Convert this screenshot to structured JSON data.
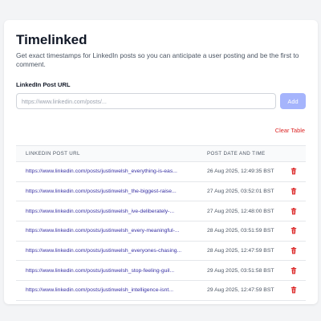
{
  "app": {
    "title": "Timelinked",
    "subtitle": "Get exact timestamps for LinkedIn posts so you can anticipate a user posting and be the first to comment."
  },
  "form": {
    "label": "LinkedIn Post URL",
    "placeholder": "https://www.linkedin.com/posts/...",
    "value": "",
    "add_label": "Add"
  },
  "table": {
    "clear_label": "Clear Table",
    "headers": {
      "url": "LinkedIn Post URL",
      "date": "Post Date and Time"
    },
    "rows": [
      {
        "url": "https://www.linkedin.com/posts/justinwelsh_everything-is-eas...",
        "date": "26 Aug 2025, 12:49:35 BST"
      },
      {
        "url": "https://www.linkedin.com/posts/justinwelsh_the-biggest-raise...",
        "date": "27 Aug 2025, 03:52:01 BST"
      },
      {
        "url": "https://www.linkedin.com/posts/justinwelsh_ive-deliberately-...",
        "date": "27 Aug 2025, 12:48:00 BST"
      },
      {
        "url": "https://www.linkedin.com/posts/justinwelsh_every-meaningful-...",
        "date": "28 Aug 2025, 03:51:59 BST"
      },
      {
        "url": "https://www.linkedin.com/posts/justinwelsh_everyones-chasing...",
        "date": "28 Aug 2025, 12:47:59 BST"
      },
      {
        "url": "https://www.linkedin.com/posts/justinwelsh_stop-feeling-guil...",
        "date": "29 Aug 2025, 03:51:58 BST"
      },
      {
        "url": "https://www.linkedin.com/posts/justinwelsh_intelligence-isnt...",
        "date": "29 Aug 2025, 12:47:59 BST"
      }
    ]
  },
  "colors": {
    "accent": "#a5b4fc",
    "link": "#3730a3",
    "danger": "#dc2626"
  },
  "icons": {
    "delete": "trash-icon"
  }
}
